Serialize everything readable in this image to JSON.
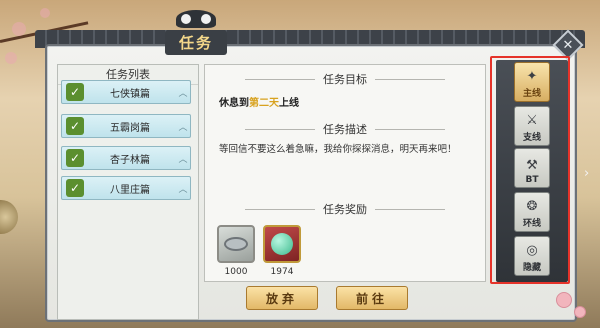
{
  "window": {
    "title": "任务",
    "close_icon": "close-icon"
  },
  "quest_list": {
    "header": "任务列表",
    "items": [
      {
        "label": "七侠镇篇",
        "completed": true
      },
      {
        "label": "五霸岗篇",
        "completed": true
      },
      {
        "label": "杏子林篇",
        "completed": true
      },
      {
        "label": "八里庄篇",
        "completed": true
      }
    ]
  },
  "detail": {
    "goal_title": "任务目标",
    "goal_prefix": "休息到",
    "goal_highlight": "第二天",
    "goal_suffix": "上线",
    "desc_title": "任务描述",
    "description": "等回信不要这么着急嘛，我给你探探消息，明天再来吧！",
    "reward_title": "任务奖励",
    "rewards": [
      {
        "icon": "silver-coin-icon",
        "value": "1000"
      },
      {
        "icon": "jade-orb-icon",
        "value": "1974"
      }
    ]
  },
  "buttons": {
    "abandon": "放弃",
    "go": "前往"
  },
  "tabs": [
    {
      "label": "主线",
      "icon": "main-quest-icon",
      "active": true
    },
    {
      "label": "支线",
      "icon": "side-quest-icon",
      "active": false
    },
    {
      "label": "BT",
      "icon": "bt-quest-icon",
      "active": false
    },
    {
      "label": "环线",
      "icon": "loop-quest-icon",
      "active": false
    },
    {
      "label": "隐藏",
      "icon": "hidden-quest-icon",
      "active": false
    }
  ],
  "colors": {
    "highlight": "#e5332a",
    "goal_highlight": "#d8a21f",
    "active_tab": "#d7ae62"
  }
}
